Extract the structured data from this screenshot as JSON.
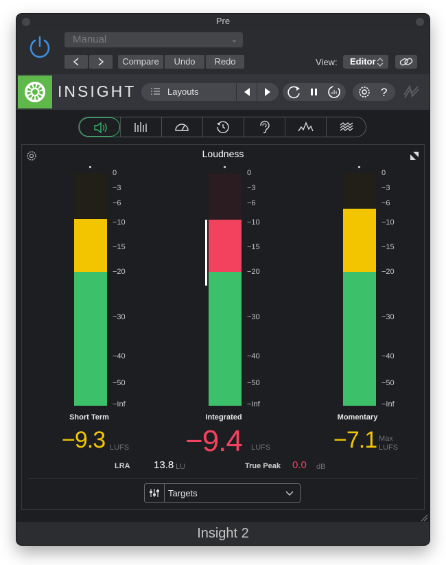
{
  "window": {
    "title": "Pre"
  },
  "host": {
    "preset": "Manual",
    "compare": "Compare",
    "undo": "Undo",
    "redo": "Redo",
    "view_label": "View:",
    "view_value": "Editor"
  },
  "plugin": {
    "brand": "INSIGHT",
    "layouts": "Layouts"
  },
  "panel": {
    "title": "Loudness"
  },
  "scale": [
    "0",
    "−3",
    "−6",
    "−10",
    "−15",
    "−20",
    "−30",
    "−40",
    "−50",
    "−Inf"
  ],
  "meters": [
    {
      "label": "Short Term",
      "value": "−9.3",
      "unit": "LUFS",
      "color": "#f2c500",
      "level_lufs": -9.3
    },
    {
      "label": "Integrated",
      "value": "−9.4",
      "unit": "LUFS",
      "color": "#f2425e",
      "level_lufs": -9.4
    },
    {
      "label": "Momentary",
      "value": "−7.1",
      "unit_line1": "Max",
      "unit": "LUFS",
      "color": "#f2c500",
      "level_lufs": -7.1
    }
  ],
  "lra": {
    "label": "LRA",
    "value": "13.8",
    "unit": "LU"
  },
  "true_peak": {
    "label": "True Peak",
    "value": "0.0",
    "unit": "dB"
  },
  "targets": {
    "label": "Targets"
  },
  "footer": {
    "title": "Insight 2"
  },
  "colors": {
    "green": "#3cc06a",
    "yellow": "#f2c500",
    "red": "#f2425e",
    "accent": "#36b76a"
  }
}
